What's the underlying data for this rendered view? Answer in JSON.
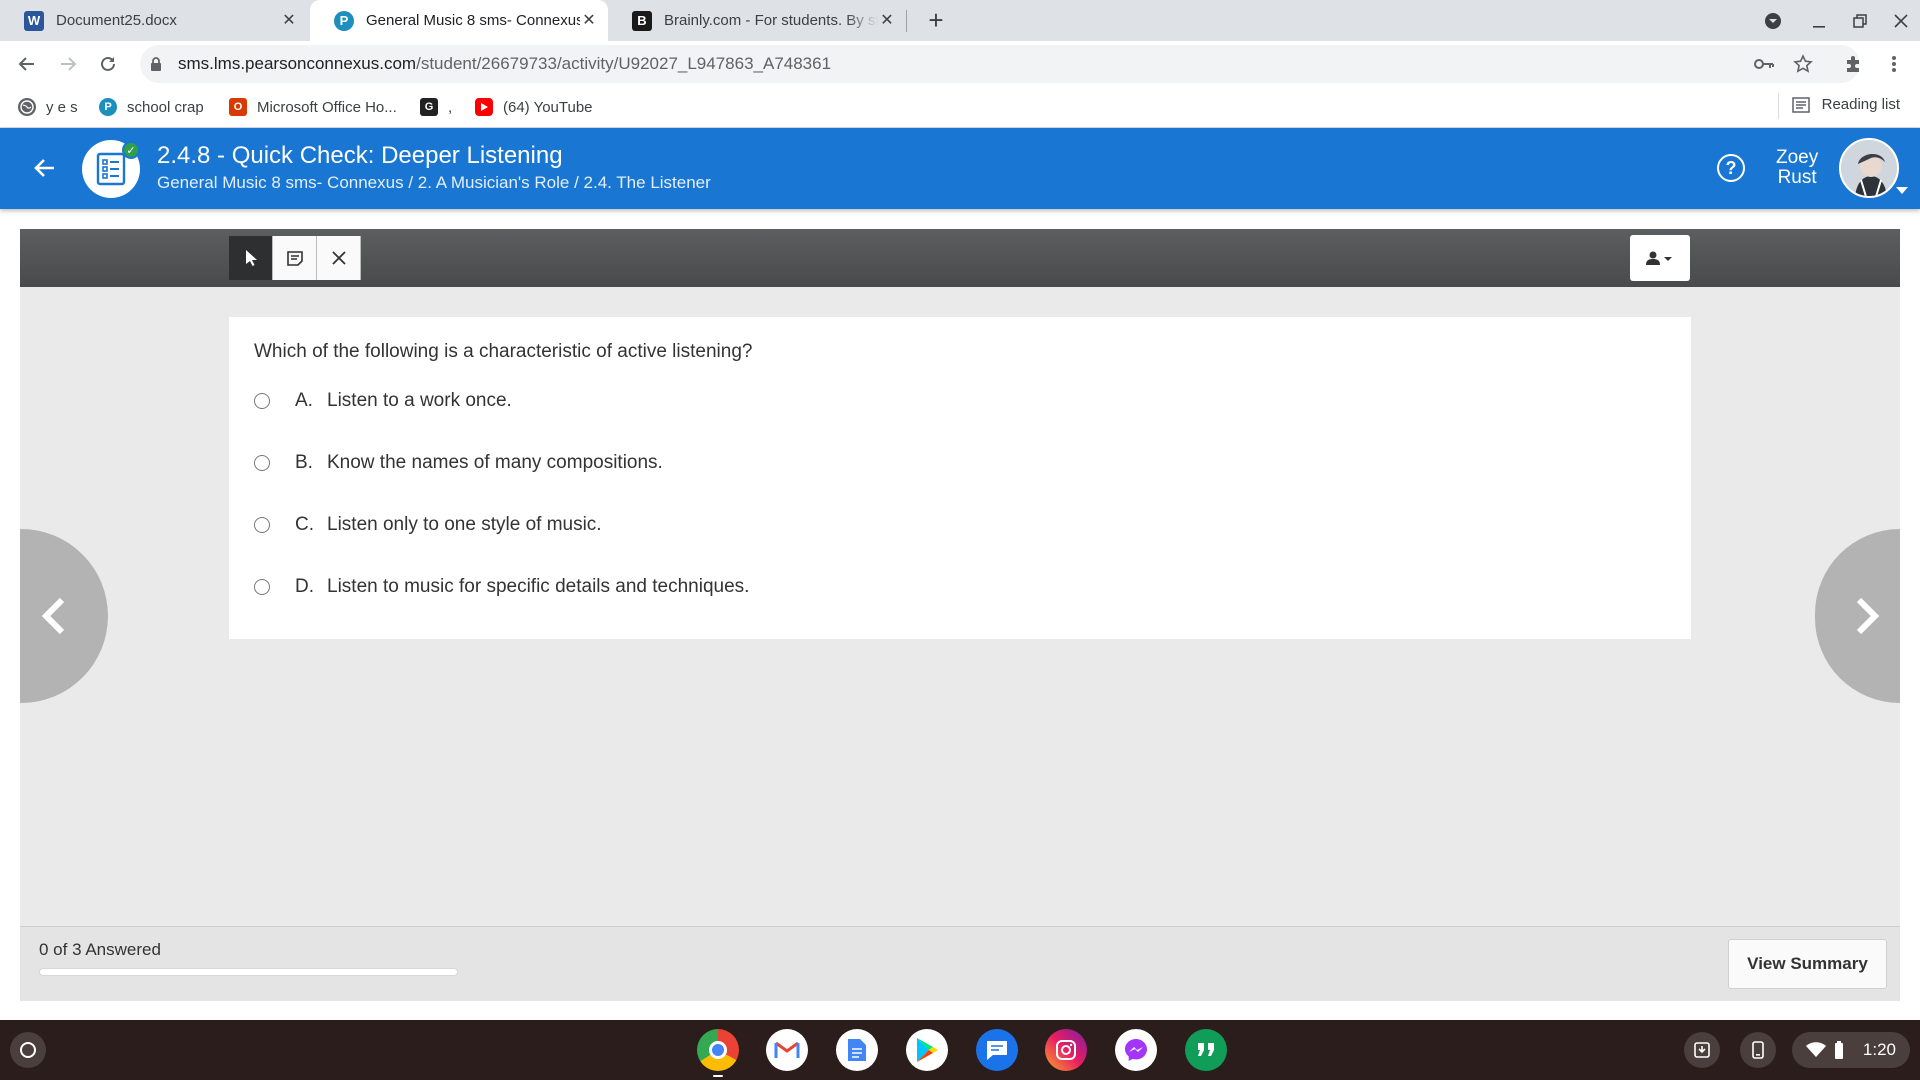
{
  "browser": {
    "tabs": [
      {
        "title": "Document25.docx",
        "icon": "word-icon",
        "active": false
      },
      {
        "title": "General Music 8 sms- Connexus",
        "icon": "pearson-icon",
        "active": true
      },
      {
        "title": "Brainly.com - For students. By stu",
        "icon": "brainly-icon",
        "active": false
      }
    ],
    "url_host": "sms.lms.pearsonconnexus.com",
    "url_path": "/student/26679733/activity/U92027_L947863_A748361",
    "bookmarks": [
      {
        "label": "y e s",
        "icon": "globe-icon"
      },
      {
        "label": "school crap",
        "icon": "pearson-icon"
      },
      {
        "label": "Microsoft Office Ho...",
        "icon": "office-icon"
      },
      {
        "label": ",",
        "icon": "g-icon"
      },
      {
        "label": "(64) YouTube",
        "icon": "youtube-icon"
      }
    ],
    "reading_list": "Reading list"
  },
  "header": {
    "title": "2.4.8 - Quick Check: Deeper Listening",
    "breadcrumb": "General Music 8 sms- Connexus / 2. A Musician's Role / 2.4. The Listener",
    "user_first": "Zoey",
    "user_last": "Rust"
  },
  "question": {
    "text": "Which of the following is a characteristic of active listening?",
    "choices": [
      {
        "letter": "A.",
        "text": "Listen to a work once."
      },
      {
        "letter": "B.",
        "text": "Know the names of many compositions."
      },
      {
        "letter": "C.",
        "text": "Listen only to one style of music."
      },
      {
        "letter": "D.",
        "text": "Listen to music for specific details and techniques."
      }
    ]
  },
  "footer": {
    "answered_text": "0 of 3 Answered",
    "progress_fraction": 0,
    "view_summary_label": "View Summary"
  },
  "shelf": {
    "apps": [
      "chrome-icon",
      "gmail-icon",
      "docs-icon",
      "play-store-icon",
      "messages-icon",
      "instagram-icon",
      "messenger-icon",
      "hangouts-icon"
    ],
    "time": "1:20"
  },
  "colors": {
    "brand_blue": "#1976d2",
    "toolbar_dark": "#4f5152",
    "tab_strip": "#dee1e6"
  }
}
